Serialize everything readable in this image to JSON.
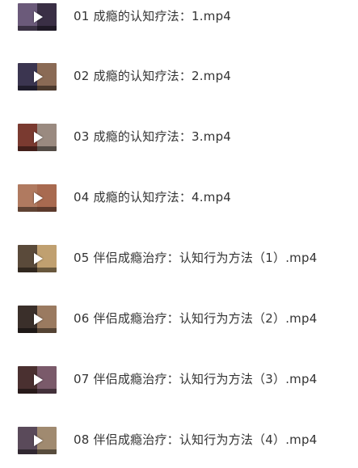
{
  "files": [
    {
      "name": "01 成瘾的认知疗法：1.mp4",
      "thumbnail": {
        "left_color": "#6b5a7a",
        "right_color": "#3a2f45"
      },
      "icon": "play-icon"
    },
    {
      "name": "02 成瘾的认知疗法：2.mp4",
      "thumbnail": {
        "left_color": "#3b3550",
        "right_color": "#8a6a55"
      },
      "icon": "play-icon"
    },
    {
      "name": "03 成瘾的认知疗法：3.mp4",
      "thumbnail": {
        "left_color": "#7a3a30",
        "right_color": "#9a8a80"
      },
      "icon": "play-icon"
    },
    {
      "name": "04 成瘾的认知疗法：4.mp4",
      "thumbnail": {
        "left_color": "#b07a60",
        "right_color": "#a86a50"
      },
      "icon": "play-icon"
    },
    {
      "name": "05 伴侣成瘾治疗：认知行为方法（1）.mp4",
      "thumbnail": {
        "left_color": "#5a4a3a",
        "right_color": "#c0a070"
      },
      "icon": "play-icon"
    },
    {
      "name": "06 伴侣成瘾治疗：认知行为方法（2）.mp4",
      "thumbnail": {
        "left_color": "#3a2f2a",
        "right_color": "#9a7a60"
      },
      "icon": "play-icon"
    },
    {
      "name": "07 伴侣成瘾治疗：认知行为方法（3）.mp4",
      "thumbnail": {
        "left_color": "#4a3030",
        "right_color": "#7a5a6a"
      },
      "icon": "play-icon"
    },
    {
      "name": "08 伴侣成瘾治疗：认知行为方法（4）.mp4",
      "thumbnail": {
        "left_color": "#5a4a5a",
        "right_color": "#a08a70"
      },
      "icon": "play-icon"
    }
  ]
}
